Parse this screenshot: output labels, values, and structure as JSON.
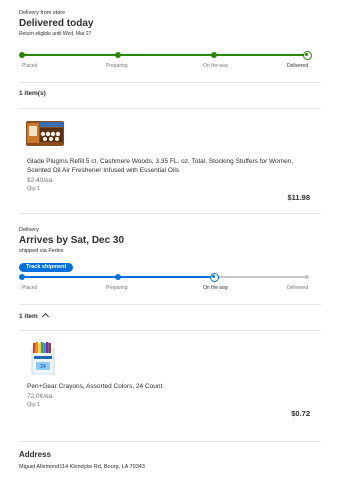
{
  "order1": {
    "source": "Delivery from store",
    "status": "Delivered today",
    "return_note": "Return eligible until Wed, Mar 27",
    "steps": [
      "Placed",
      "Preparing",
      "On the way",
      "Delivered"
    ],
    "current_step": 3,
    "item_count_label": "1 item(s)",
    "item": {
      "name": "Glade PlugIns Refill 5 ct, Cashmere Woods, 3.35 FL. oz. Total, Stocking Stuffers for Women, Scented Oil Air Freshener Infused with Essential Oils",
      "unit_price": "$2.40/ea",
      "qty": "Qty 1",
      "price": "$11.98",
      "image_icon": "air-freshener-pack-image"
    }
  },
  "order2": {
    "type": "Delivery",
    "status": "Arrives by Sat, Dec 30",
    "shipped_via": "shipped via Fedex",
    "track_label": "Track shipment",
    "steps": [
      "Placed",
      "Preparing",
      "On the way",
      "Delivered"
    ],
    "current_step": 2,
    "item_count_label": "1 item",
    "item": {
      "name": "Pen+Gear Crayons, Assorted Colors, 24 Count",
      "unit_price": "72.0¢/ea",
      "qty": "Qty 1",
      "price": "$0.72",
      "image_icon": "crayons-box-image"
    }
  },
  "address": {
    "heading": "Address",
    "line": "Miguel Allemond114 Klondyke Rd, Bourg, LA 70343"
  },
  "colors": {
    "green": "#2a8703",
    "blue": "#0071dc",
    "gray": "#c7c7c9"
  }
}
